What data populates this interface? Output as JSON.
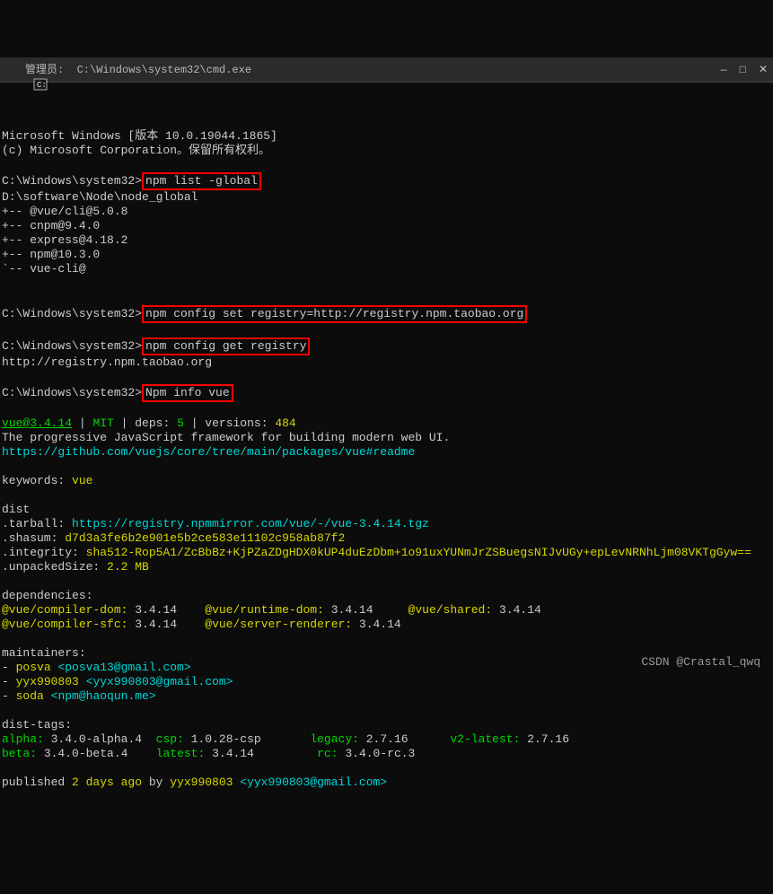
{
  "title": "管理员:  C:\\Windows\\system32\\cmd.exe",
  "header": {
    "line1": "Microsoft Windows [版本 10.0.19044.1865]",
    "line2": "(c) Microsoft Corporation。保留所有权利。"
  },
  "prompt1": "C:\\Windows\\system32>",
  "cmd1": "npm list -global",
  "list_root": "D:\\software\\Node\\node_global",
  "pkgs": [
    "+-- @vue/cli@5.0.8",
    "+-- cnpm@9.4.0",
    "+-- express@4.18.2",
    "+-- npm@10.3.0",
    "`-- vue-cli@"
  ],
  "prompt2": "C:\\Windows\\system32>",
  "cmd2": "npm config set registry=http://registry.npm.taobao.org",
  "prompt3": "C:\\Windows\\system32>",
  "cmd3": "npm config get registry",
  "reg_out": "http://registry.npm.taobao.org",
  "prompt4": "C:\\Windows\\system32>",
  "cmd4": "Npm info vue",
  "vue": {
    "name": "vue@",
    "ver": "3.4.14",
    "license": "MIT",
    "deps_label": "deps:",
    "deps": "5",
    "versions_label": "versions:",
    "versions": "484",
    "desc": "The progressive JavaScript framework for building modern web UI.",
    "url": "https://github.com/vuejs/core/tree/main/packages/vue#readme"
  },
  "keywords_label": "keywords:",
  "keywords_val": "vue",
  "dist_label": "dist",
  "tarball_label": ".tarball:",
  "tarball_url": "https://registry.npmmirror.com/vue/-/vue-3.4.14.tgz",
  "shasum_label": ".shasum:",
  "shasum_val": "d7d3a3fe6b2e901e5b2ce583e11102c958ab87f2",
  "integrity_label": ".integrity:",
  "integrity_val": "sha512-Rop5A1/ZcBbBz+KjPZaZDgHDX0kUP4duEzDbm+1o91uxYUNmJrZSBuegsNIJvUGy+epLevNRNhLjm08VKTgGyw==",
  "unpacked_label": ".unpackedSize:",
  "unpacked_val": "2.2 MB",
  "deps_section": "dependencies:",
  "dep1_name": "@vue/compiler-dom:",
  "dep1_ver": "3.4.14",
  "dep2_name": "@vue/runtime-dom:",
  "dep2_ver": "3.4.14",
  "dep3_name": "@vue/shared:",
  "dep3_ver": "3.4.14",
  "dep4_name": "@vue/compiler-sfc:",
  "dep4_ver": "3.4.14",
  "dep5_name": "@vue/server-renderer:",
  "dep5_ver": "3.4.14",
  "maint_label": "maintainers:",
  "m1_name": "posva",
  "m1_mail": "<posva13@gmail.com>",
  "m2_name": "yyx990803",
  "m2_mail": "<yyx990803@gmail.com>",
  "m3_name": "soda",
  "m3_mail": "<npm@haoqun.me>",
  "dash": "- ",
  "dist_tags_label": "dist-tags:",
  "dt_alpha_k": "alpha:",
  "dt_alpha_v": "3.4.0-alpha.4",
  "dt_csp_k": "csp:",
  "dt_csp_v": "1.0.28-csp",
  "dt_legacy_k": "legacy:",
  "dt_legacy_v": "2.7.16",
  "dt_v2_k": "v2-latest:",
  "dt_v2_v": "2.7.16",
  "dt_beta_k": "beta:",
  "dt_beta_v": "3.4.0-beta.4",
  "dt_latest_k": "latest:",
  "dt_latest_v": "3.4.14",
  "dt_rc_k": "rc:",
  "dt_rc_v": "3.4.0-rc.3",
  "published_prefix": "published ",
  "published_time": "2 days ago",
  "published_by": " by ",
  "published_user": "yyx990803",
  "published_mail": " <yyx990803@gmail.com>",
  "watermark": "CSDN @Crastal_qwq"
}
